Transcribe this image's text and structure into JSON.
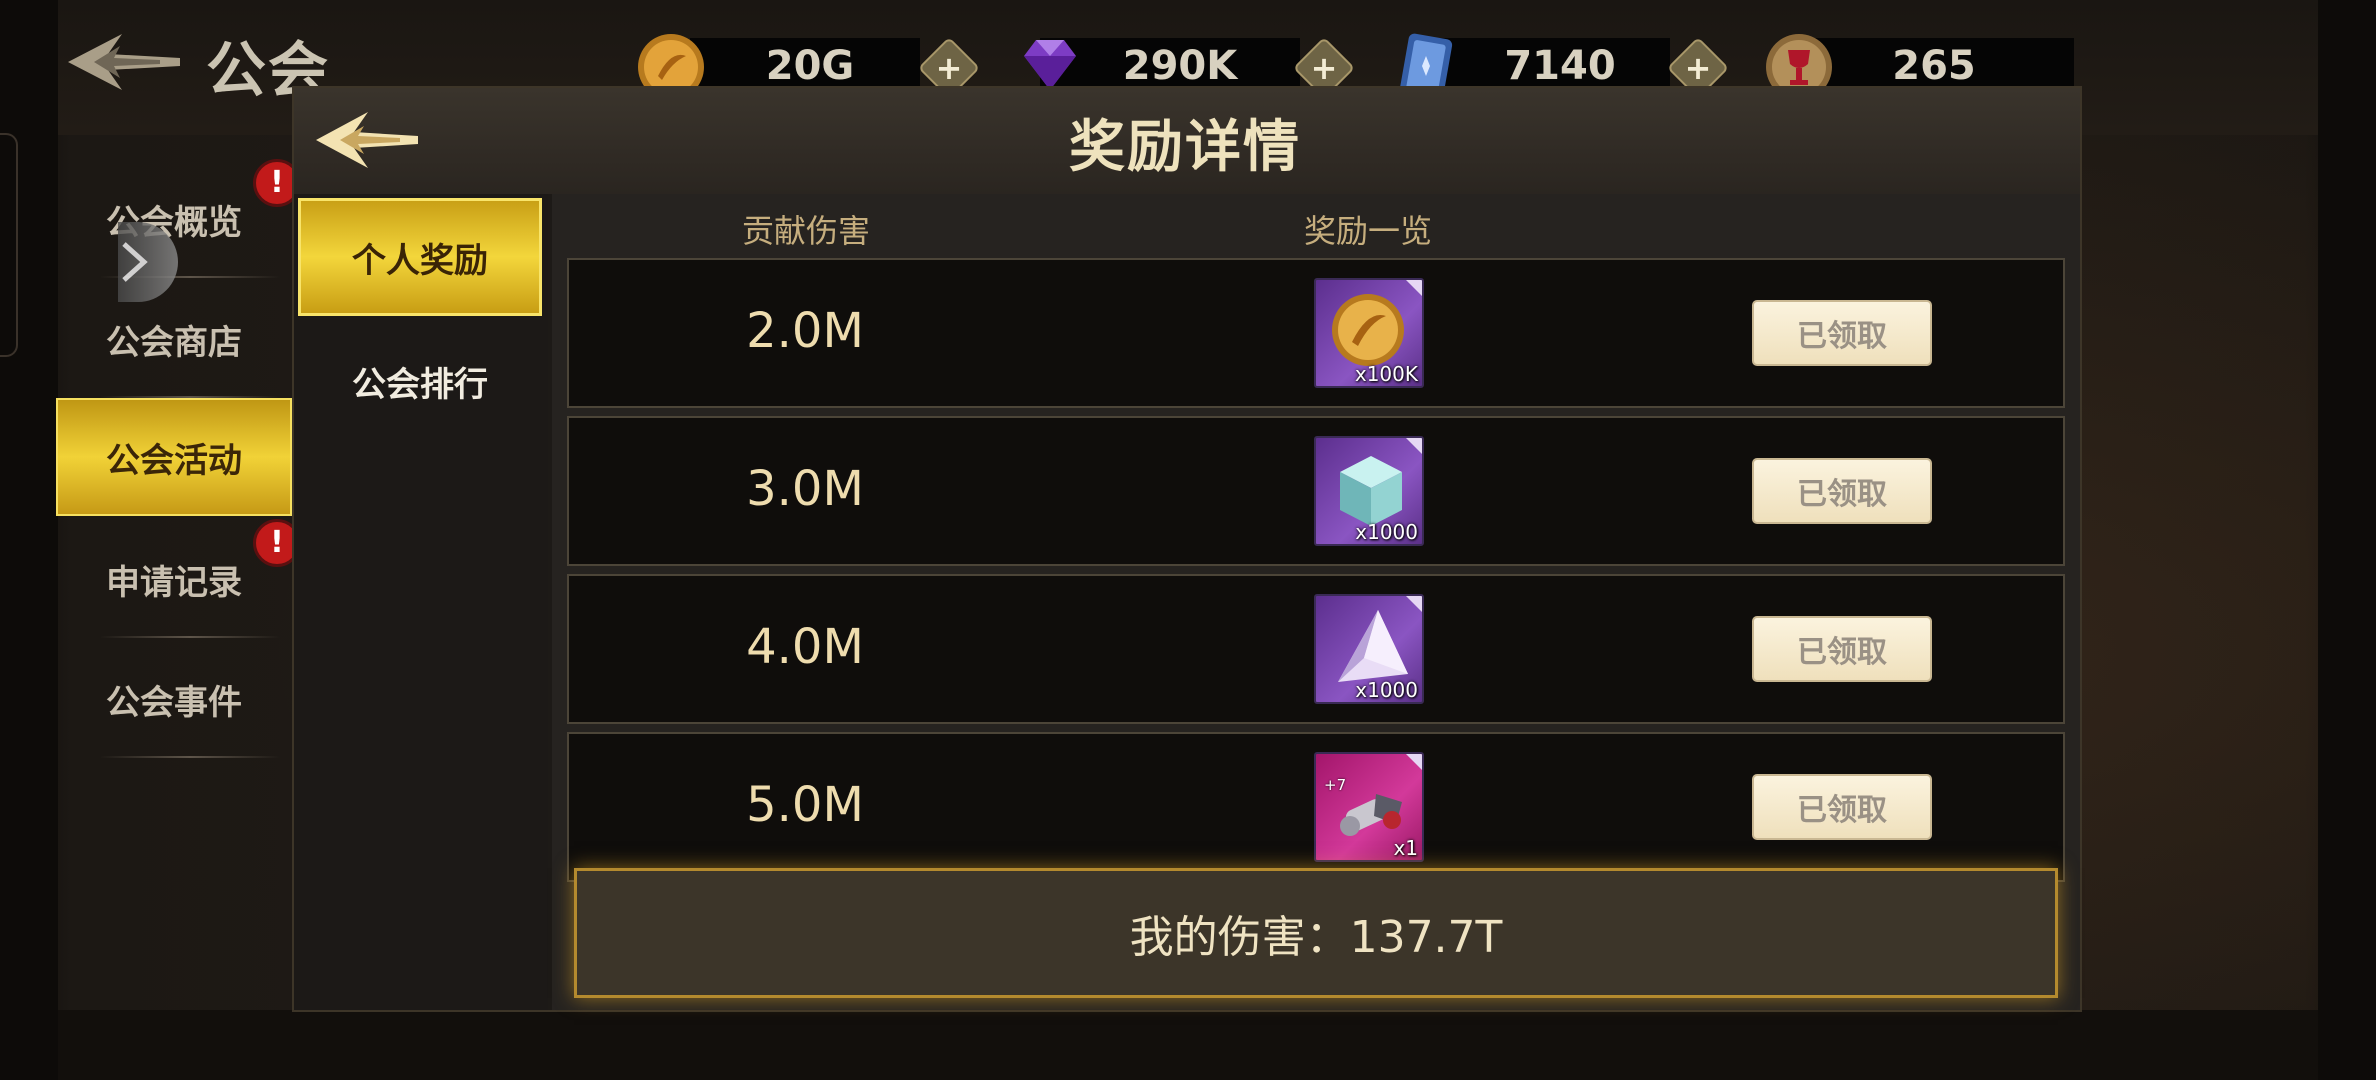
{
  "topbar": {
    "title": "公会",
    "resources": [
      {
        "icon": "gold-coin-icon",
        "value": "20G"
      },
      {
        "icon": "purple-gem-icon",
        "value": "290K"
      },
      {
        "icon": "blue-ticket-icon",
        "value": "7140"
      },
      {
        "icon": "trophy-icon",
        "value": "265"
      }
    ]
  },
  "sidebar": {
    "items": [
      {
        "label": "公会概览"
      },
      {
        "label": "公会商店"
      },
      {
        "label": "公会活动"
      },
      {
        "label": "申请记录"
      },
      {
        "label": "公会事件"
      }
    ],
    "alert_glyph": "!"
  },
  "panel": {
    "title": "奖励详情",
    "tabs": [
      {
        "label": "个人奖励"
      },
      {
        "label": "公会排行"
      }
    ],
    "columns": {
      "damage": "贡献伤害",
      "rewards": "奖励一览"
    },
    "rows": [
      {
        "damage": "2.0M",
        "item_icon": "gold-coin-icon",
        "qty": "x100K",
        "status": "已领取"
      },
      {
        "damage": "3.0M",
        "item_icon": "crystal-cube-icon",
        "qty": "x1000",
        "status": "已领取"
      },
      {
        "damage": "4.0M",
        "item_icon": "crystal-shard-icon",
        "qty": "x1000",
        "status": "已领取"
      },
      {
        "damage": "5.0M",
        "item_icon": "equipment-scroll-icon",
        "qty": "x1",
        "level": "+7",
        "status": "已领取"
      }
    ],
    "my_damage": "我的伤害：137.7T"
  },
  "colors": {
    "accent_gold": "#f1d237",
    "panel_bg": "#1d1a17",
    "alert_red": "#c21a1a"
  }
}
